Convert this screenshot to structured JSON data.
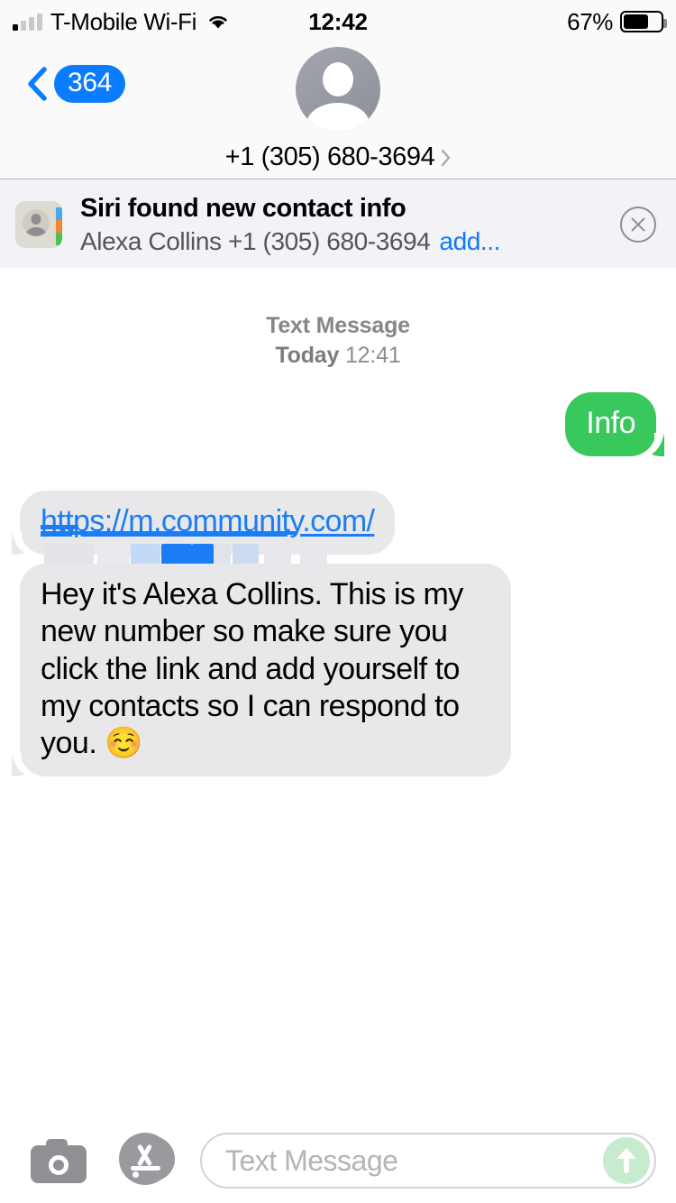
{
  "status_bar": {
    "carrier": "T-Mobile Wi-Fi",
    "time": "12:42",
    "battery_percent": "67%",
    "signal_bars_filled": 1,
    "signal_bars_total": 4,
    "wifi_icon": "wifi-icon",
    "battery_icon": "battery-icon"
  },
  "header": {
    "back_badge": "364",
    "back_icon": "chevron-left-icon",
    "avatar_icon": "person-placeholder-avatar",
    "contact_name": "+1 (305) 680-3694",
    "detail_icon": "chevron-right-icon"
  },
  "siri_banner": {
    "icon": "contacts-app-icon",
    "title": "Siri found new contact info",
    "subtitle": "Alexa Collins +1 (305) 680-3694",
    "add_link": "add...",
    "close_icon": "close-circle-icon",
    "link_color": "#0a7cff",
    "background": "#f2f2f7"
  },
  "conversation": {
    "divider": {
      "kind": "Text Message",
      "day": "Today",
      "time": "12:41"
    },
    "messages": [
      {
        "id": "outgoing-info",
        "direction": "outgoing",
        "type": "text",
        "text": "Info",
        "bubble_color": "#38c85c",
        "text_color": "#ffffff"
      },
      {
        "id": "incoming-link",
        "direction": "incoming",
        "type": "link",
        "link_text": "https://m.community.com/",
        "link_color": "#1a7df5",
        "second_line": "[redacted]",
        "bubble_color": "#e8e8ea"
      },
      {
        "id": "incoming-text",
        "direction": "incoming",
        "type": "text",
        "text": "Hey it's Alexa Collins. This is my new number so make sure you click the link and add yourself to my contacts so I can respond to you. ☺️",
        "bubble_color": "#e8e8ea",
        "text_color": "#000000"
      }
    ]
  },
  "toolbar": {
    "camera_icon": "camera-icon",
    "appstore_icon": "app-store-icon",
    "input_placeholder": "Text Message",
    "input_value": "",
    "send_icon": "arrow-up-icon",
    "send_enabled": false,
    "send_color": "#c6ebcf"
  }
}
